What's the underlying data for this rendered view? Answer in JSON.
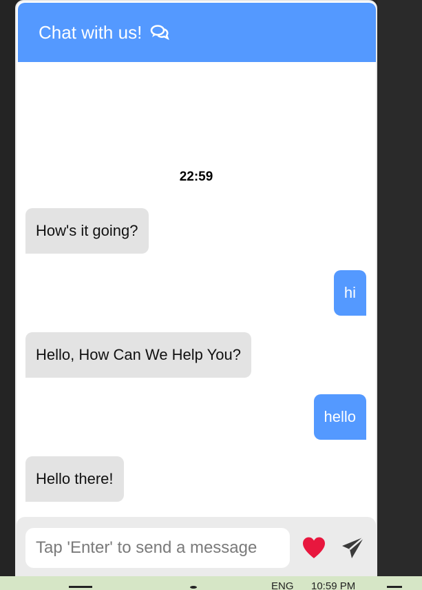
{
  "header": {
    "title": "Chat with us!",
    "icon": "chat-bubbles-icon"
  },
  "conversation": {
    "timestamp": "22:59",
    "messages": [
      {
        "sender": "bot",
        "text": "How's it going?"
      },
      {
        "sender": "user",
        "text": "hi"
      },
      {
        "sender": "bot",
        "text": "Hello, How Can We Help You?"
      },
      {
        "sender": "user",
        "text": "hello"
      },
      {
        "sender": "bot",
        "text": "Hello there!"
      }
    ]
  },
  "composer": {
    "placeholder": "Tap 'Enter' to send a message",
    "value": "",
    "heart_icon": "heart-icon",
    "send_icon": "send-icon"
  },
  "taskbar": {
    "language": "ENG",
    "time": "10:59 PM"
  },
  "colors": {
    "accent": "#5499ff",
    "bot_bubble": "#e3e3e3",
    "heart": "#e8173e",
    "background": "#242424"
  }
}
